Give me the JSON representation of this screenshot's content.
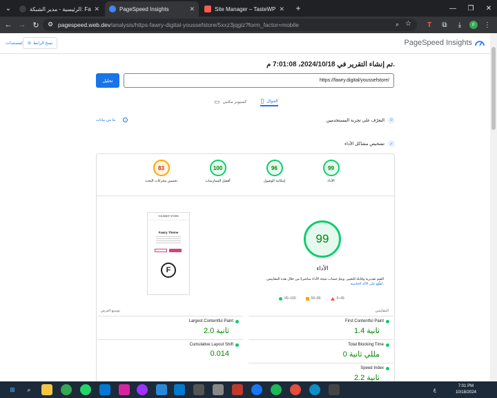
{
  "browser": {
    "tabs": [
      {
        "title": "الرئيسية - مدير الشبكة: Fawry Digital",
        "active": false
      },
      {
        "title": "PageSpeed Insights",
        "active": true
      },
      {
        "title": "Site Manager – TasteWP",
        "active": false
      }
    ],
    "new_tab": "+",
    "url_host": "pagespeed.web.dev",
    "url_rest": "/analysis/https-fawry-digital-youssefstore/5xxz3jqgiz?form_factor=mobile",
    "profile_initial": "F"
  },
  "header": {
    "logo_text": "PageSpeed Insights",
    "copy_link_label": "نسخ الرابط",
    "docs_label": "المستندات"
  },
  "report": {
    "title": "تم إنشاء التقرير في 2024/10/18، 7:01:08 م.",
    "url_value": "https://fawry.digital/youssefstore/",
    "analyze_label": "تحليل",
    "tab_mobile": "الجوال",
    "tab_desktop": "كمبيوتر مكتبي",
    "ux_section": "التعرّف على تجربة المستخدمين",
    "no_data": "ما من بيانات",
    "diag_section": "تشخيص مشاكل الأداء"
  },
  "scores": [
    {
      "label": "الأداء",
      "value": "99",
      "color": "green"
    },
    {
      "label": "إمكانية الوصول",
      "value": "96",
      "color": "green"
    },
    {
      "label": "أفضل الممارسات",
      "value": "100",
      "color": "green"
    },
    {
      "label": "تحسين محركات البحث",
      "value": "83",
      "color": "orange"
    }
  ],
  "performance": {
    "score": "99",
    "label": "الأداء",
    "desc": "القيم تقديرية وقابلة للتغيير. ويتمّ حساب نتيجة الأداء مباشرةً من خلال هذه المقاييس.",
    "desc_link": "اطّلِع على الآلة الحاسبة.",
    "legend": [
      "0–49",
      "50–89",
      "90–100"
    ]
  },
  "screenshot": {
    "store_name": "YOUSSEF STORE",
    "theme_title": "Fawry Theme"
  },
  "metrics_heads": {
    "right": "المقاييس",
    "left": "توسيع العرض"
  },
  "metrics": [
    {
      "name": "First Contentful Paint",
      "value": "1.4 ثانية"
    },
    {
      "name": "Largest Contentful Paint",
      "value": "2.0 ثانية"
    },
    {
      "name": "Total Blocking Time",
      "value": "0 مللي ثانية"
    },
    {
      "name": "Cumulative Layout Shift",
      "value": "0.014"
    },
    {
      "name": "Speed Index",
      "value": "2.2 ثانية"
    }
  ],
  "taskbar": {
    "time": "7:01 PM",
    "date": "10/18/2024",
    "lang": "ع"
  },
  "colors": {
    "accent": "#1a73e8",
    "good": "#0cce6b",
    "avg": "#ffa400",
    "poor": "#ff4e42"
  }
}
